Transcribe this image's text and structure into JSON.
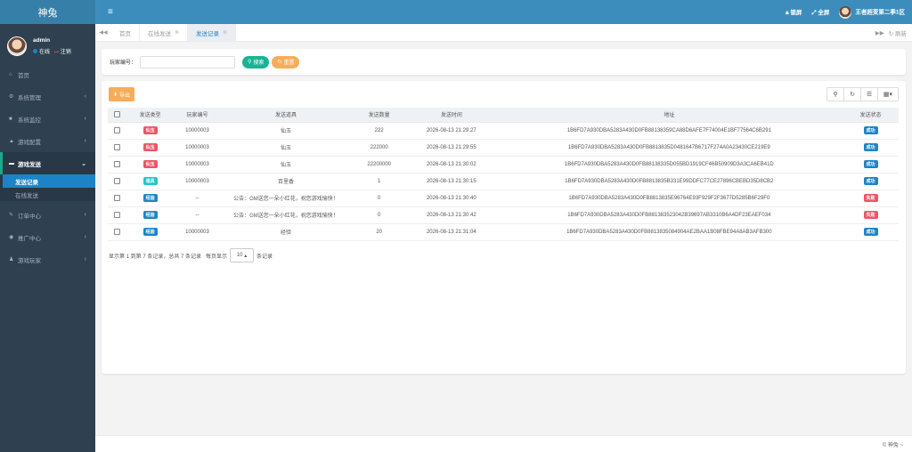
{
  "app": {
    "logo": "神兔"
  },
  "user": {
    "name": "admin",
    "online": "在线",
    "logout": "注销"
  },
  "header": {
    "menu_icon": "bars-icon",
    "lock": "锁屏",
    "fullscreen": "全屏",
    "server": "王者超变第二季1区"
  },
  "sidebar": {
    "items": [
      {
        "label": "首页",
        "icon": "home-icon"
      },
      {
        "label": "系统管理",
        "icon": "gear-icon"
      },
      {
        "label": "系统监控",
        "icon": "video-icon"
      },
      {
        "label": "游戏配置",
        "icon": "car-icon"
      },
      {
        "label": "游戏发送",
        "icon": "card-icon"
      },
      {
        "label": "订单中心",
        "icon": "wrench-icon"
      },
      {
        "label": "推广中心",
        "icon": "eye-icon"
      },
      {
        "label": "游戏玩家",
        "icon": "user-icon"
      }
    ],
    "sub_items": [
      {
        "label": "发送记录"
      },
      {
        "label": "在线发送"
      }
    ]
  },
  "tabs": {
    "items": [
      {
        "label": "首页"
      },
      {
        "label": "在线发送"
      },
      {
        "label": "发送记录"
      }
    ],
    "refresh": "刷新"
  },
  "search": {
    "label": "玩家编号：",
    "search_btn": "搜索",
    "reset_btn": "重置"
  },
  "toolbar": {
    "export": "导出"
  },
  "table": {
    "headers": [
      "发送类型",
      "玩家编号",
      "发送道具",
      "发送数量",
      "发送时间",
      "地址",
      "发送状态"
    ],
    "rows": [
      {
        "type": "仙玉",
        "type_color": "#ed5565",
        "player": "10000003",
        "item": "仙玉",
        "qty": "222",
        "time": "2026-08-13 21:29:27",
        "addr": "1B6FD7A930DBA5283A430D0FB88138359CA88D6AFE7F74004E1BF77564C6B291",
        "status": "成功",
        "status_color": "#1c84c6"
      },
      {
        "type": "仙玉",
        "type_color": "#ed5565",
        "player": "10000003",
        "item": "仙玉",
        "qty": "222000",
        "time": "2026-08-13 21:29:55",
        "addr": "1B6FD7A930DBA5283A430D0FB8813835D0481647B6717F274A0A23430CE219E9",
        "status": "成功",
        "status_color": "#1c84c6"
      },
      {
        "type": "仙玉",
        "type_color": "#ed5565",
        "player": "10000003",
        "item": "仙玉",
        "qty": "22200000",
        "time": "2026-08-13 21:30:02",
        "addr": "1B6FD7A930DBA5283A430D0FB88138335D055BD1919CF46B50909D3A3CA6EB41D",
        "status": "成功",
        "status_color": "#1c84c6"
      },
      {
        "type": "道具",
        "type_color": "#23c6c8",
        "player": "10000003",
        "item": "百里香",
        "qty": "1",
        "time": "2026-08-13 21:30:15",
        "addr": "1B6FD7A930DBA5283A430D0FB8813835B331E99DDFC77CE27896CBEBD35D8CB2",
        "status": "成功",
        "status_color": "#1c84c6"
      },
      {
        "type": "经验",
        "type_color": "#1c84c6",
        "player": "--",
        "item": "公告：GM送您一朵小红花，祝您游戏愉快！",
        "qty": "0",
        "time": "2026-08-13 21:30:40",
        "addr": "1B6FD7A930DBA5283A430D0FB8813835E96764E93F929F2F3677D5285B6F29F0",
        "status": "失败",
        "status_color": "#ed5565"
      },
      {
        "type": "经验",
        "type_color": "#1c84c6",
        "player": "--",
        "item": "公告：GM送您一朵小红花，祝您游戏愉快！",
        "qty": "0",
        "time": "2026-08-13 21:30:42",
        "addr": "1B6FD7A930DBA5283A430D0FB881383523042B39697AB3310B6A4DF23EAEF034",
        "status": "失败",
        "status_color": "#ed5565"
      },
      {
        "type": "经验",
        "type_color": "#1c84c6",
        "player": "10000003",
        "item": "经验",
        "qty": "20",
        "time": "2026-08-13 21:31:04",
        "addr": "1B6FD7A930DBA5283A430D0FB8813835084904AE2BAA1B08FBE94A8AB3AFB300",
        "status": "成功",
        "status_color": "#1c84c6"
      }
    ]
  },
  "pagination": {
    "summary": "显示第 1 到第 7 条记录，总共 7 条记录",
    "per_page_prefix": "每页显示",
    "per_page": "10",
    "per_page_suffix": "条记录"
  },
  "footer": {
    "copyright": "© 神兔 ~"
  }
}
